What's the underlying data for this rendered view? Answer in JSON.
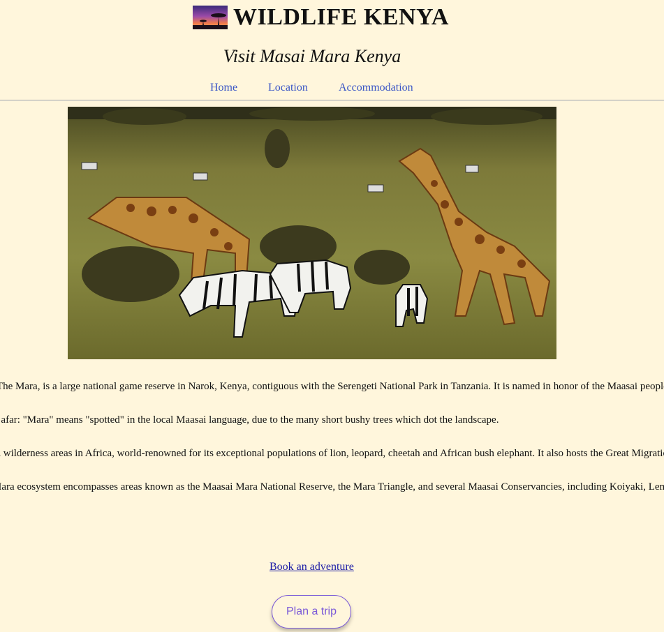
{
  "brand": {
    "title": "WILDLIFE KENYA",
    "logo_icon": "sunset-acacia-logo"
  },
  "subtitle": "Visit Masai Mara Kenya",
  "nav": {
    "items": [
      {
        "label": "Home"
      },
      {
        "label": "Location"
      },
      {
        "label": "Accommodation"
      }
    ]
  },
  "hero": {
    "image_icon": "savanna-giraffes-zebras-photo"
  },
  "content": {
    "paragraphs": [
      "as The Mara, is a large national game reserve in Narok, Kenya, contiguous with the Serengeti National Park in Tanzania. It is named in honor of the Maasai people",
      "m afar: \"Mara\" means \"spotted\" in the local Maasai language, due to the many short bushy trees which dot the landscape.",
      "nd wilderness areas in Africa, world-renowned for its exceptional populations of lion, leopard, cheetah and African bush elephant. It also hosts the Great Migration",
      "Mara ecosystem encompasses areas known as the Maasai Mara National Reserve, the Mara Triangle, and several Maasai Conservancies, including Koiyaki, Lemek"
    ]
  },
  "cta": {
    "link_text": "Book an adventure",
    "button_label": "Plan a trip"
  },
  "colors": {
    "background": "#fff6dc",
    "nav_link": "#3a55c6",
    "button_accent": "#7a58d8"
  }
}
